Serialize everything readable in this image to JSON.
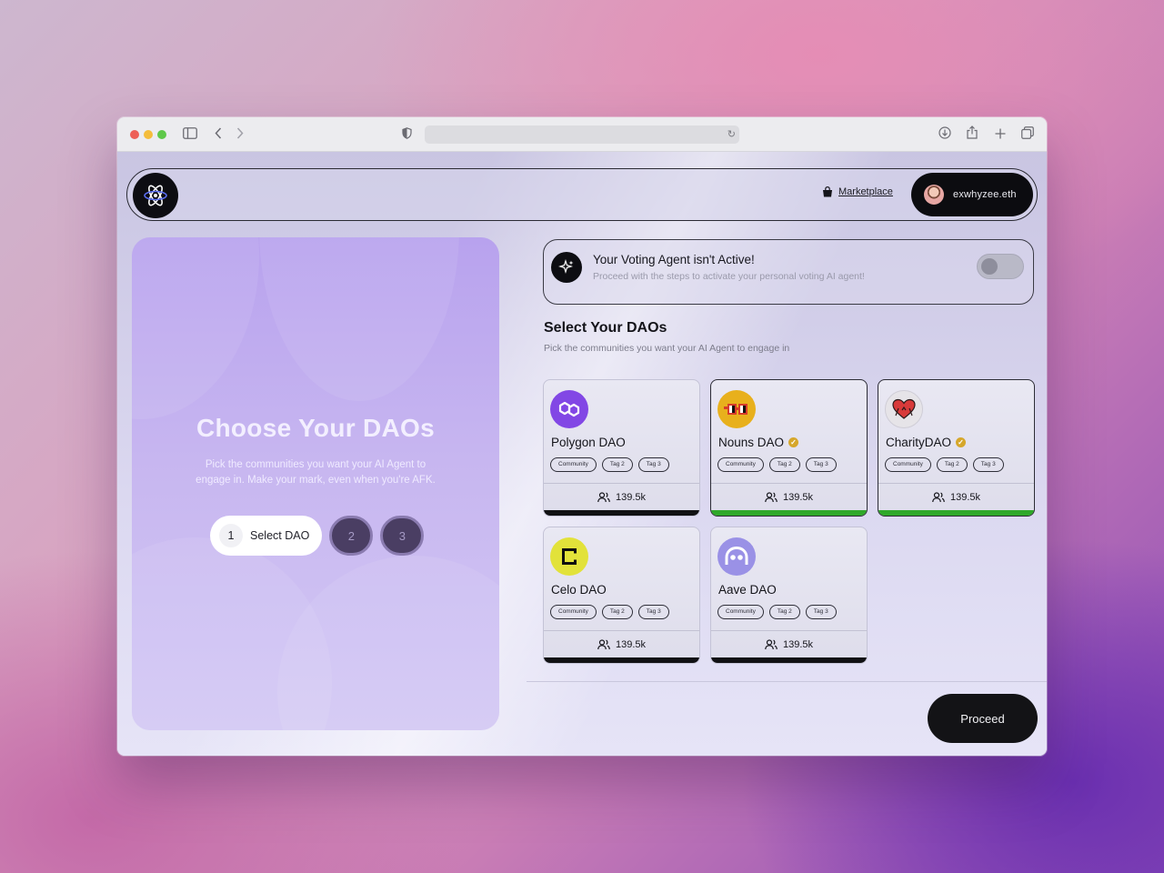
{
  "browser": {
    "url": ""
  },
  "navbar": {
    "marketplace_label": "Marketplace",
    "username": "exwhyzee.eth"
  },
  "hero": {
    "title": "Choose Your DAOs",
    "subtitle": "Pick the communities you want your AI Agent to engage in. Make your mark, even when you're AFK.",
    "steps": [
      {
        "number": "1",
        "label": "Select DAO",
        "active": true
      },
      {
        "number": "2",
        "active": false
      },
      {
        "number": "3",
        "active": false
      }
    ]
  },
  "agent_status": {
    "title": "Your Voting Agent isn't Active!",
    "subtitle": "Proceed with the steps to activate your personal voting AI agent!",
    "toggle_on": false
  },
  "dao_section": {
    "title": "Select Your DAOs",
    "subtitle": "Pick the communities you want your AI Agent to engage in"
  },
  "daos": [
    {
      "name": "Polygon DAO",
      "verified": false,
      "tags": [
        "Community",
        "Tag 2",
        "Tag 3"
      ],
      "members": "139.5k",
      "selected": false,
      "bar_color": "#111114"
    },
    {
      "name": "Nouns DAO",
      "verified": true,
      "tags": [
        "Community",
        "Tag 2",
        "Tag 3"
      ],
      "members": "139.5k",
      "selected": true,
      "bar_color": "#2fa82a"
    },
    {
      "name": "CharityDAO",
      "verified": true,
      "tags": [
        "Community",
        "Tag 2",
        "Tag 3"
      ],
      "members": "139.5k",
      "selected": true,
      "bar_color": "#2fa82a"
    },
    {
      "name": "Celo DAO",
      "verified": false,
      "tags": [
        "Community",
        "Tag 2",
        "Tag 3"
      ],
      "members": "139.5k",
      "selected": false,
      "bar_color": "#111114"
    },
    {
      "name": "Aave DAO",
      "verified": false,
      "tags": [
        "Community",
        "Tag 2",
        "Tag 3"
      ],
      "members": "139.5k",
      "selected": false,
      "bar_color": "#111114"
    }
  ],
  "proceed_label": "Proceed",
  "colors": {
    "accent_green": "#2fa82a",
    "dark": "#0d0d12",
    "hero_purple": "#b8a2ee"
  }
}
